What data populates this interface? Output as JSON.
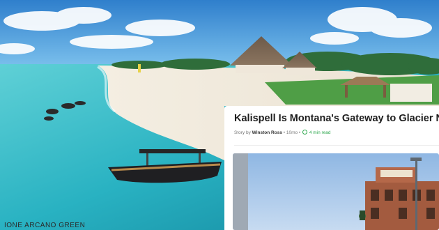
{
  "caption": {
    "text": "IONE ARCANO GREEN"
  },
  "card": {
    "title": "Kalispell Is Montana's Gateway to Glacier National Park",
    "byline_prefix": "Story by",
    "author": "Winston Ross",
    "age": "10mo",
    "read_time": "4 min read"
  },
  "colors": {
    "accent_green": "#2fa84f",
    "title": "#1d1d1d",
    "sea": "#2bb7c7",
    "sky": "#3d8fd6"
  }
}
